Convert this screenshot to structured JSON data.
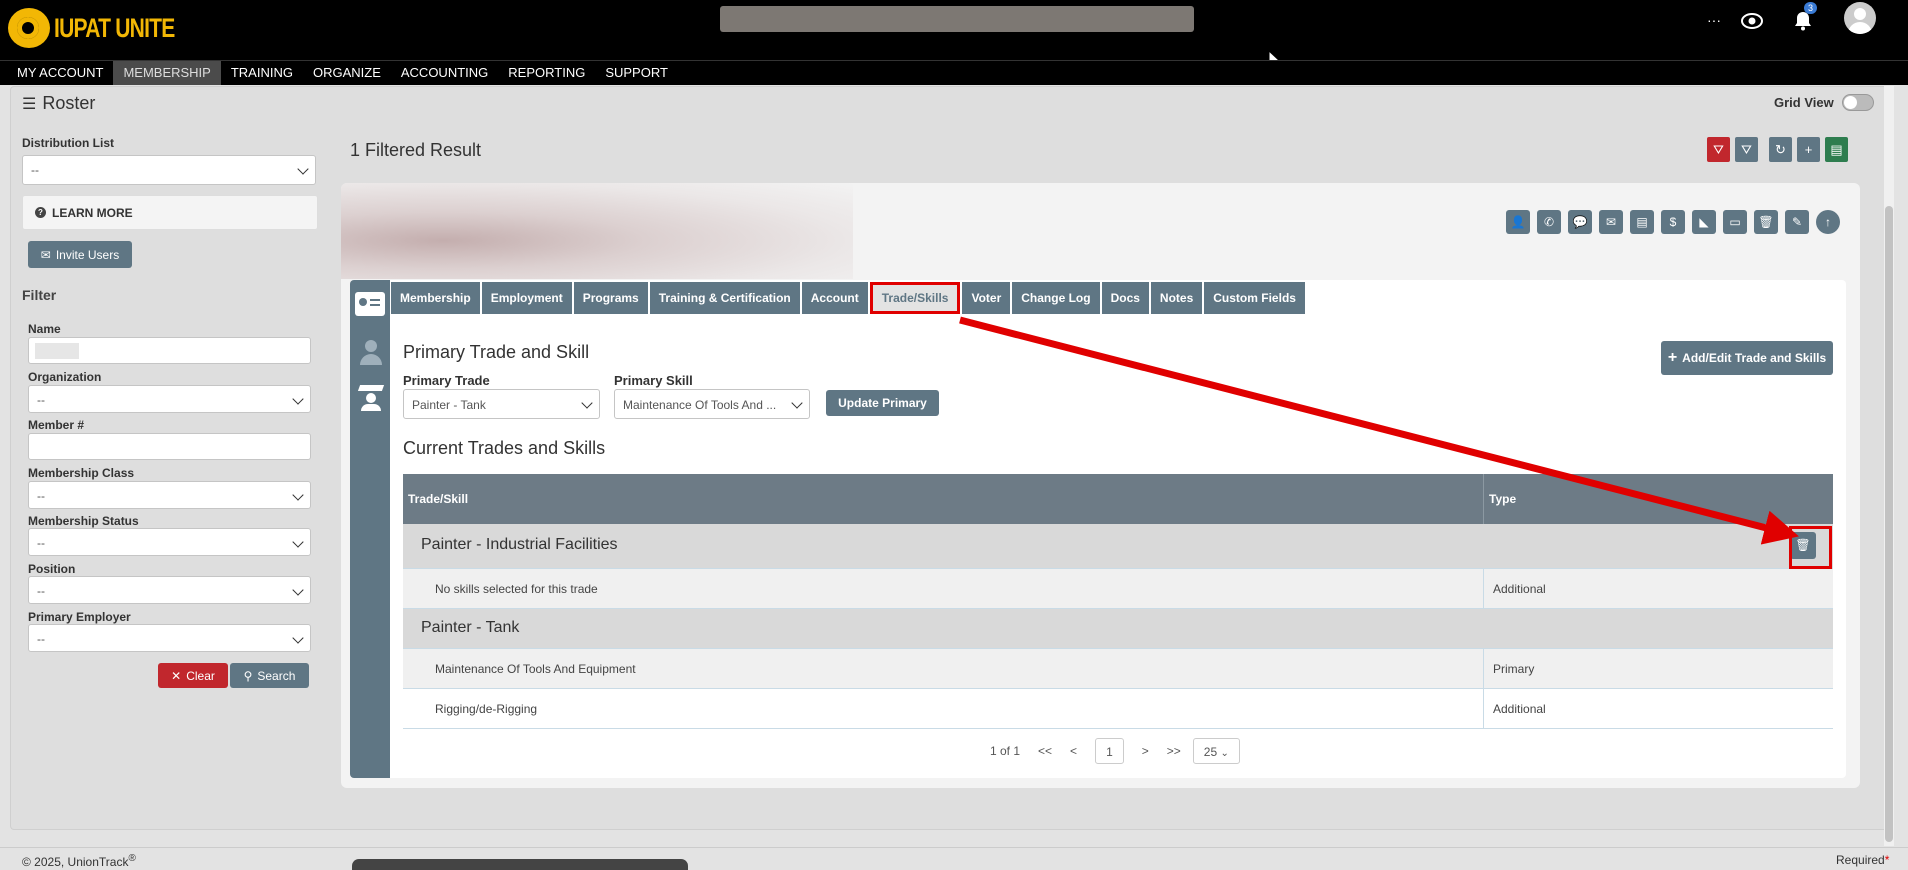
{
  "app": {
    "brand": "IUPAT UNITE",
    "logo_sub": "IUPAT",
    "notification_count": "3",
    "more": "···"
  },
  "nav": [
    "MY ACCOUNT",
    "MEMBERSHIP",
    "TRAINING",
    "ORGANIZE",
    "ACCOUNTING",
    "REPORTING",
    "SUPPORT"
  ],
  "nav_active": "MEMBERSHIP",
  "page": {
    "title": "Roster",
    "grid_view_label": "Grid View"
  },
  "sidebar": {
    "distribution_label": "Distribution List",
    "distribution_value": "--",
    "learn_more": "LEARN MORE",
    "invite_users": "Invite Users",
    "filter_heading": "Filter",
    "name_label": "Name",
    "organization_label": "Organization",
    "organization_value": "--",
    "member_label": "Member #",
    "class_label": "Membership Class",
    "class_value": "--",
    "status_label": "Membership Status",
    "status_value": "--",
    "position_label": "Position",
    "position_value": "--",
    "employer_label": "Primary Employer",
    "employer_value": "--",
    "clear": "Clear",
    "search": "Search"
  },
  "results": {
    "count_text": "1 Filtered Result"
  },
  "tabs": [
    "Membership",
    "Employment",
    "Programs",
    "Training & Certification",
    "Account",
    "Trade/Skills",
    "Voter",
    "Change Log",
    "Docs",
    "Notes",
    "Custom Fields"
  ],
  "active_tab": "Trade/Skills",
  "primary": {
    "heading": "Primary Trade and Skill",
    "trade_label": "Primary Trade",
    "trade_value": "Painter - Tank",
    "skill_label": "Primary Skill",
    "skill_value": "Maintenance Of Tools And ...",
    "update_button": "Update Primary",
    "add_edit_button": "Add/Edit Trade and Skills"
  },
  "current": {
    "heading": "Current Trades and Skills",
    "col_trade": "Trade/Skill",
    "col_type": "Type",
    "groups": [
      {
        "name": "Painter - Industrial Facilities",
        "rows": [
          {
            "skill": "No skills selected for this trade",
            "type": "Additional"
          }
        ]
      },
      {
        "name": "Painter - Tank",
        "rows": [
          {
            "skill": "Maintenance Of Tools And Equipment",
            "type": "Primary"
          },
          {
            "skill": "Rigging/de-Rigging",
            "type": "Additional"
          }
        ]
      }
    ]
  },
  "pager": {
    "summary": "1 of 1",
    "first": "<<",
    "prev": "<",
    "page": "1",
    "next": ">",
    "last": ">>",
    "page_size": "25"
  },
  "footer": {
    "copyright": "© 2025, UnionTrack",
    "registered": "®",
    "required": "Required"
  },
  "colors": {
    "accent": "#5f7684",
    "danger": "#c1272d",
    "success": "#2e7d4f",
    "annotation": "#e00000",
    "brand": "#f2b705"
  }
}
